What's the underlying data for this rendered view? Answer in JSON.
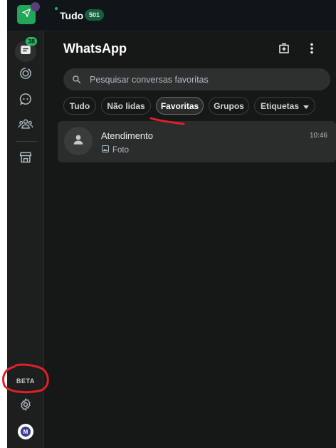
{
  "topbar": {
    "title": "Tudo",
    "count_badge": "501"
  },
  "rail": {
    "chats_badge": "38",
    "beta_label": "BETA",
    "profile_initial": "M",
    "icons": [
      "chats-icon",
      "status-icon",
      "channels-icon",
      "communities-icon",
      "business-tools-icon",
      "settings-icon"
    ]
  },
  "panel": {
    "title": "WhatsApp"
  },
  "search": {
    "placeholder": "Pesquisar conversas favoritas"
  },
  "filters": {
    "all": "Tudo",
    "unread": "Não lidas",
    "favorites": "Favoritas",
    "groups": "Grupos",
    "labels": "Etiquetas",
    "active": "Favoritas"
  },
  "chats": [
    {
      "name": "Atendimento",
      "time": "10:46",
      "preview": "Foto"
    }
  ],
  "colors": {
    "background": "#161717",
    "accent_green": "#21c063",
    "annotation_red": "#e0202a"
  }
}
